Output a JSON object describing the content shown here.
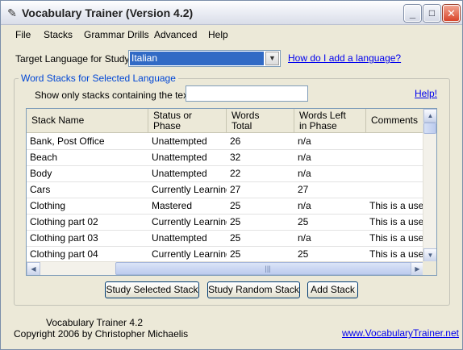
{
  "window": {
    "title": "Vocabulary Trainer (Version 4.2)",
    "icon": "book-icon"
  },
  "titlebar_buttons": {
    "minimize": "_",
    "maximize": "□",
    "close": "✕"
  },
  "menu": [
    "File",
    "Stacks",
    "Grammar Drills",
    "Advanced",
    "Help"
  ],
  "language": {
    "label": "Target Language for Study:",
    "selected": "Italian",
    "help_link": "How do I add a language?"
  },
  "stacks_group": {
    "legend": "Word Stacks for Selected Language",
    "filter_label": "Show only stacks containing the text:",
    "filter_value": "",
    "help_link": "Help!"
  },
  "table": {
    "columns": [
      {
        "l1": "Stack Name",
        "l2": ""
      },
      {
        "l1": "Status or",
        "l2": "Phase"
      },
      {
        "l1": "Words",
        "l2": "Total"
      },
      {
        "l1": "Words Left",
        "l2": "in Phase"
      },
      {
        "l1": "Comments",
        "l2": ""
      }
    ],
    "rows": [
      [
        "Bank, Post Office",
        "Unattempted",
        "26",
        "n/a",
        ""
      ],
      [
        "Beach",
        "Unattempted",
        "32",
        "n/a",
        ""
      ],
      [
        "Body",
        "Unattempted",
        "22",
        "n/a",
        ""
      ],
      [
        "Cars",
        "Currently Learning",
        "27",
        "27",
        ""
      ],
      [
        "Clothing",
        "Mastered",
        "25",
        "n/a",
        "This is a user-d"
      ],
      [
        "Clothing part 02",
        "Currently Learning",
        "25",
        "25",
        "This is a user-d"
      ],
      [
        "Clothing part 03",
        "Unattempted",
        "25",
        "n/a",
        "This is a user-d"
      ],
      [
        "Clothing part 04",
        "Currently Learning",
        "25",
        "25",
        "This is a user-d"
      ]
    ]
  },
  "buttons": {
    "study_selected": "Study Selected Stack",
    "study_random": "Study Random Stack",
    "add_stack": "Add Stack"
  },
  "footer": {
    "app_version": "Vocabulary Trainer 4.2",
    "copyright": "Copyright 2006 by Christopher Michaelis",
    "website": "www.VocabularyTrainer.net"
  },
  "colors": {
    "selection": "#316ac5",
    "link": "#0000ee",
    "group_legend": "#0046d5",
    "window_bg": "#ece9d8"
  }
}
